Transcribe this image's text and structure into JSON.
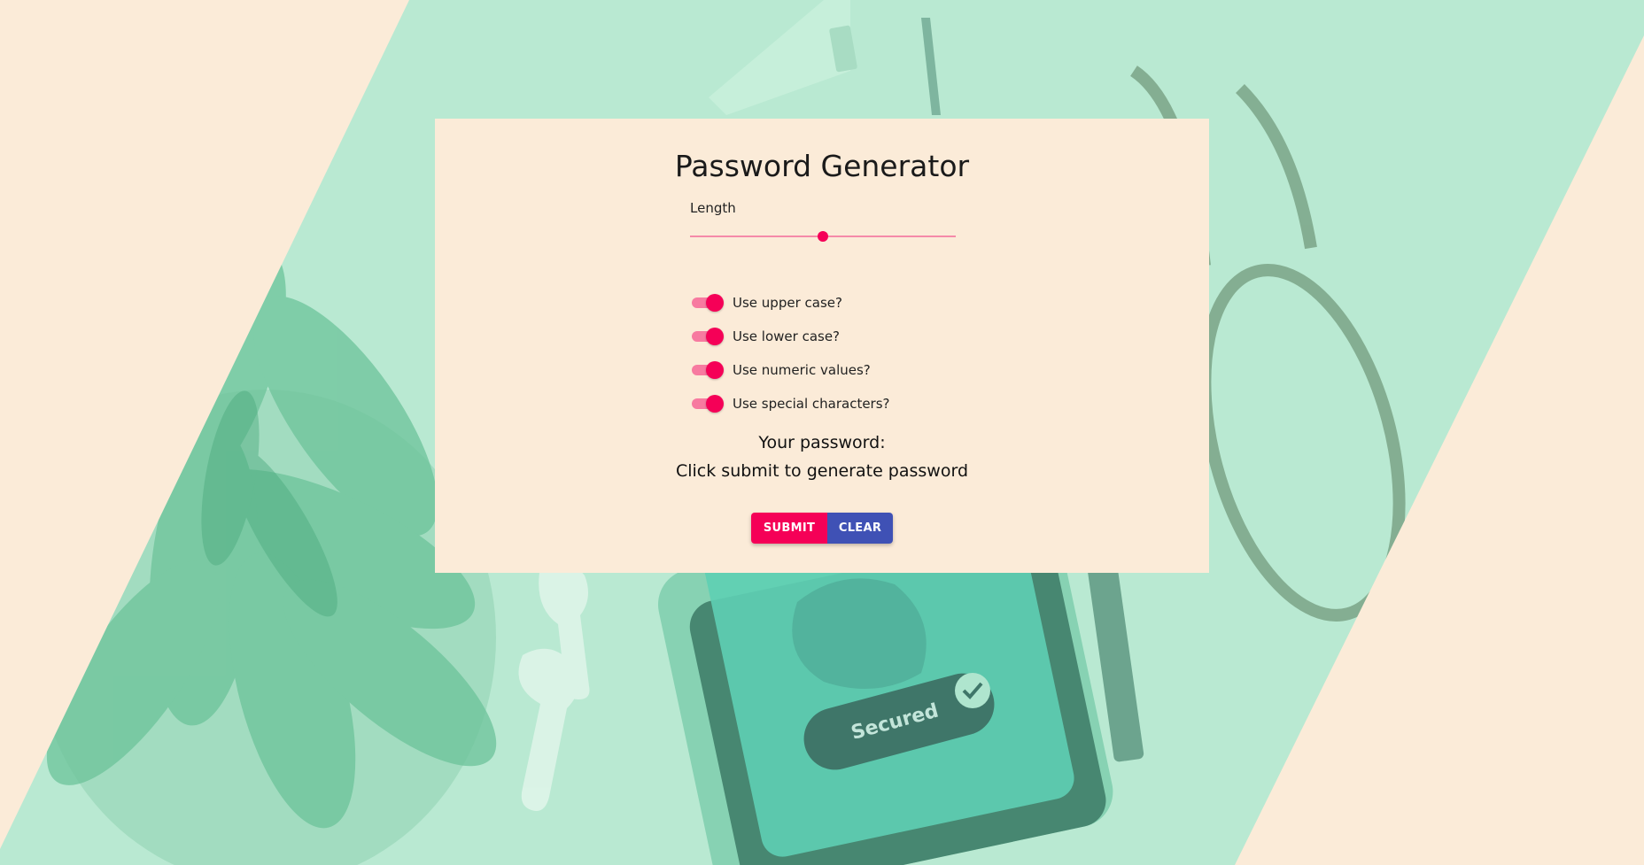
{
  "app": {
    "title": "Password Generator"
  },
  "length": {
    "label": "Length",
    "slider_fraction": 0.5
  },
  "options": [
    {
      "label": "Use upper case?",
      "checked": true
    },
    {
      "label": "Use lower case?",
      "checked": true
    },
    {
      "label": "Use numeric values?",
      "checked": true
    },
    {
      "label": "Use special characters?",
      "checked": true
    }
  ],
  "result": {
    "heading": "Your password:",
    "value": "Click submit to generate password"
  },
  "actions": {
    "submit_label": "SUBMIT",
    "clear_label": "CLEAR"
  },
  "background": {
    "phone_badge_text": "Secured"
  },
  "colors": {
    "page_bg": "#fbebd8",
    "band_green": "#b9e9d2",
    "accent_pink": "#f50057",
    "clear_blue": "#3f51b5"
  }
}
